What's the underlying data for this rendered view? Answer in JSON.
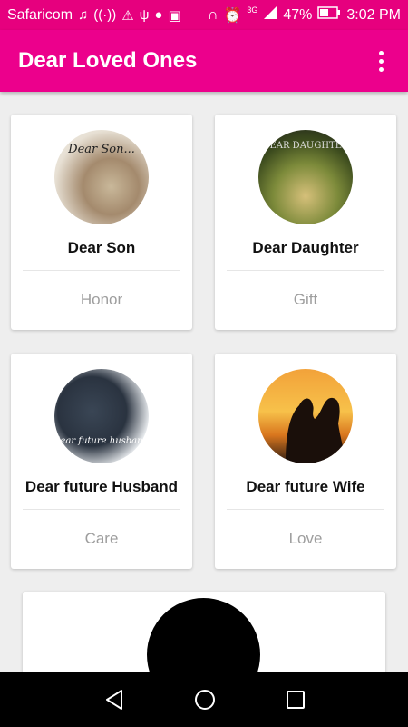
{
  "status": {
    "carrier": "Safaricom",
    "network": "3G",
    "battery": "47%",
    "time": "3:02 PM"
  },
  "appbar": {
    "title": "Dear Loved Ones"
  },
  "cards": [
    {
      "name": "Dear Son",
      "sub": "Honor",
      "avatar_text": "Dear Son..."
    },
    {
      "name": "Dear Daughter",
      "sub": "Gift",
      "avatar_text": "DEAR DAUGHTER"
    },
    {
      "name": "Dear future Husband",
      "sub": "Care",
      "avatar_text": "dear future husband"
    },
    {
      "name": "Dear future Wife",
      "sub": "Love"
    }
  ],
  "colors": {
    "status_bar": "#e6007e",
    "app_bar": "#ec008c",
    "background": "#eeeeee"
  }
}
